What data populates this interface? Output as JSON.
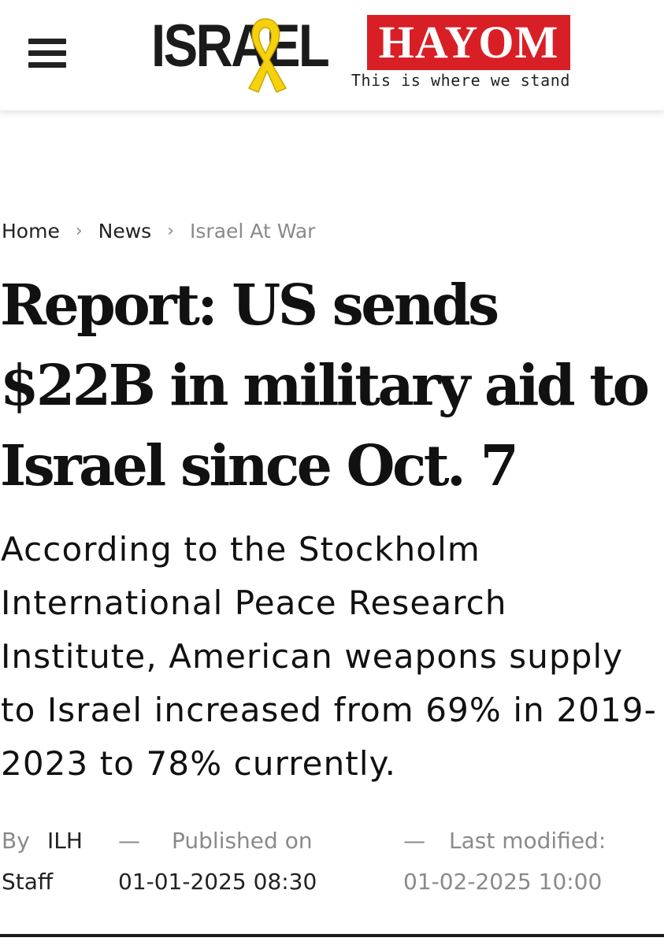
{
  "header": {
    "menu_icon": "hamburger-menu-icon",
    "logo": {
      "israel_text": "ISRAEL",
      "hayom_text": "HAYOM",
      "tagline": "This is where we stand",
      "ribbon_icon": "yellow-ribbon-icon",
      "ribbon_color": "#f5d20c",
      "brand_red": "#d81f26"
    }
  },
  "breadcrumb": {
    "items": [
      {
        "label": "Home"
      },
      {
        "label": "News"
      },
      {
        "label": "Israel At War"
      }
    ],
    "separator": "›"
  },
  "article": {
    "headline": "Report: US sends $22B in military aid to Israel since Oct. 7",
    "summary": "According to the Stockholm International Peace Research Institute, American weapons supply to Israel increased from 69% in 2019-2023 to 78% currently.",
    "byline": {
      "by_label": "By",
      "author": "ILH Staff",
      "dash": "—",
      "published_label": "Published on",
      "published_date": "01-01-2025 08:30",
      "modified_label": "Last modified:",
      "modified_date": "01-02-2025 10:00"
    }
  }
}
